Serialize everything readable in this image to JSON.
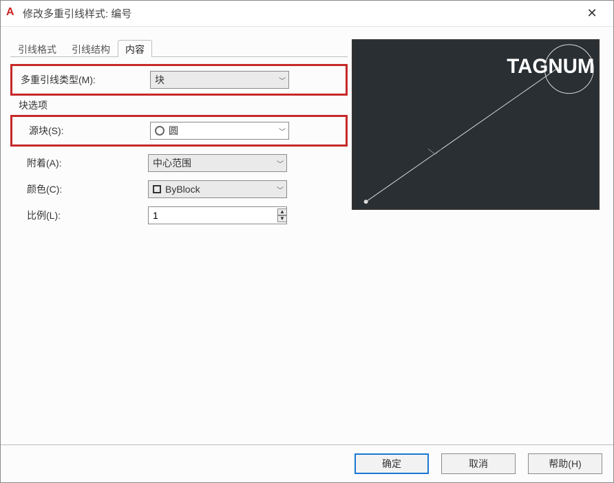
{
  "window": {
    "title": "修改多重引线样式: 编号"
  },
  "tabs": [
    {
      "label": "引线格式",
      "active": false
    },
    {
      "label": "引线结构",
      "active": false
    },
    {
      "label": "内容",
      "active": true
    }
  ],
  "form": {
    "mleader_type_label": "多重引线类型(M):",
    "mleader_type_value": "块",
    "block_options_label": "块选项",
    "source_block_label": "源块(S):",
    "source_block_value": "圆",
    "attachment_label": "附着(A):",
    "attachment_value": "中心范围",
    "color_label": "颜色(C):",
    "color_value": "ByBlock",
    "scale_label": "比例(L):",
    "scale_value": "1"
  },
  "preview": {
    "tag_text": "TAGNUM"
  },
  "buttons": {
    "ok": "确定",
    "cancel": "取消",
    "help": "帮助(H)"
  }
}
